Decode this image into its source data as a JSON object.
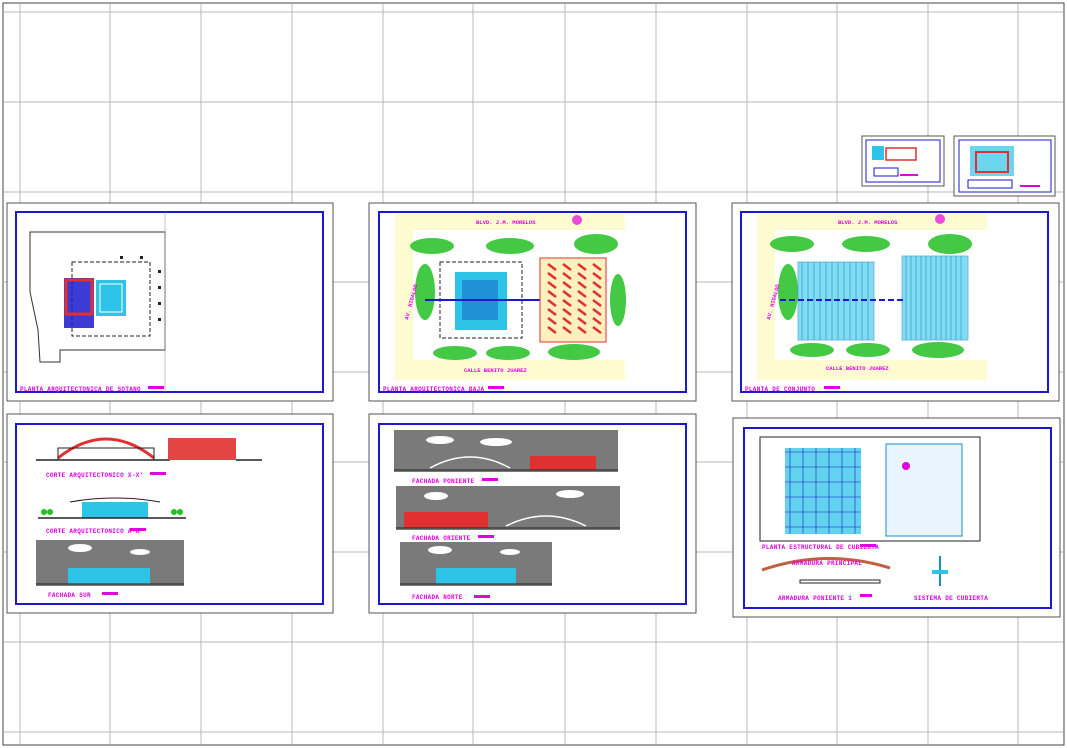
{
  "colors": {
    "background": "#ffffff",
    "grid": "#b8b8b8",
    "sheet_border": "#555555",
    "frame": "#1a1acc",
    "label": "#e000e0",
    "cyan": "#2ec4e8",
    "red": "#e03030",
    "green": "#22c022",
    "gray": "#7a7a7a"
  },
  "sheets": {
    "top_left": {
      "title": "PLANTA ARQUITECTONICA DE SOTANO"
    },
    "top_center": {
      "title": "PLANTA ARQUITECTONICA BAJA",
      "street_top": "BLVD. J.M. MORELOS",
      "street_bottom": "CALLE BENITO JUAREZ",
      "street_left": "AV. HIDALGO"
    },
    "top_right": {
      "title": "PLANTA DE CONJUNTO",
      "street_top": "BLVD. J.M. MORELOS",
      "street_bottom": "CALLE BENITO JUAREZ",
      "street_left": "AV. HIDALGO"
    },
    "bottom_left": {
      "label_1": "CORTE ARQUITECTONICO X-X'",
      "label_2": "CORTE ARQUITECTONICO A-A'",
      "label_3": "FACHADA SUR"
    },
    "bottom_center": {
      "label_1": "FACHADA PONIENTE",
      "label_2": "FACHADA ORIENTE",
      "label_3": "FACHADA NORTE"
    },
    "bottom_right": {
      "label_1": "PLANTA ESTRUCTURAL DE CUBIERTA",
      "label_2": "ARMADURA PRINCIPAL",
      "label_3": "ARMADURA PONIENTE 1",
      "label_4": "SISTEMA DE CUBIERTA"
    }
  }
}
